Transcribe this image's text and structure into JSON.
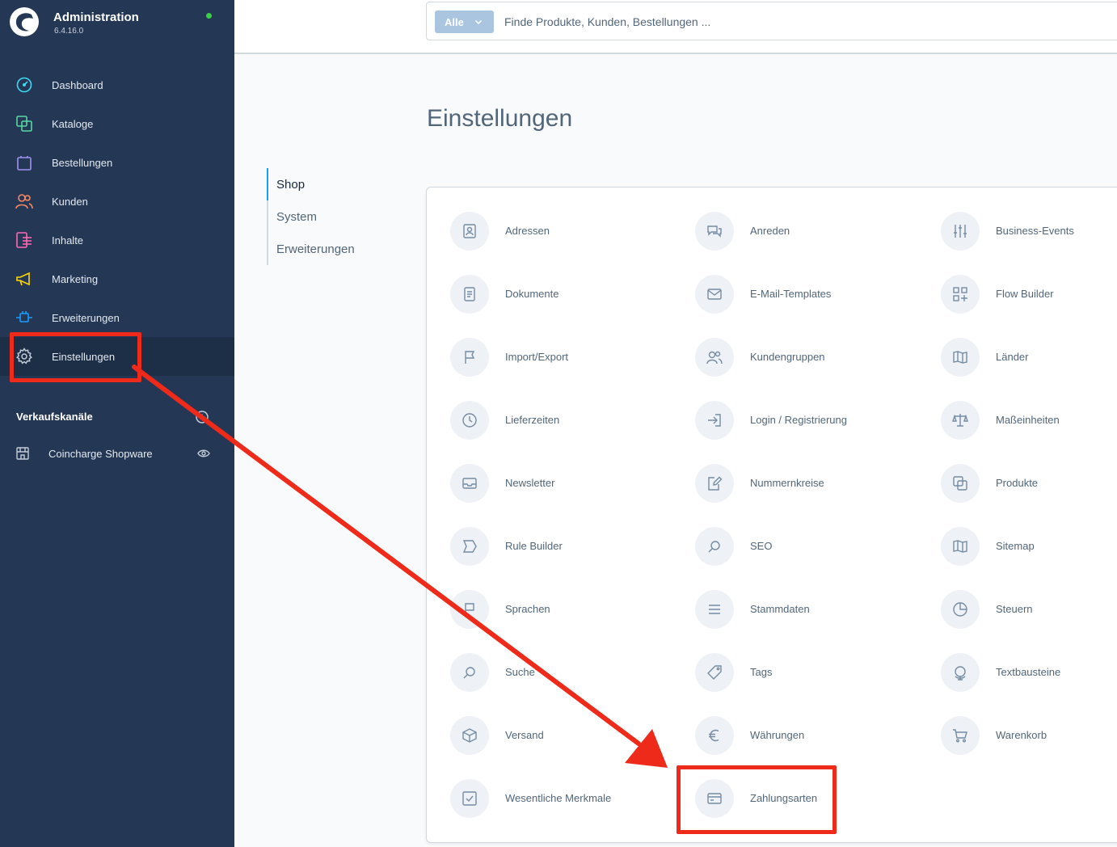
{
  "app": {
    "title": "Administration",
    "version": "6.4.16.0"
  },
  "sidebar": {
    "items": [
      {
        "label": "Dashboard",
        "icon": "dashboard-icon",
        "color": "#3ed8f4"
      },
      {
        "label": "Kataloge",
        "icon": "catalog-icon",
        "color": "#57d9a3"
      },
      {
        "label": "Bestellungen",
        "icon": "orders-icon",
        "color": "#a092f0"
      },
      {
        "label": "Kunden",
        "icon": "customers-icon",
        "color": "#f88962"
      },
      {
        "label": "Inhalte",
        "icon": "content-icon",
        "color": "#ff68b4"
      },
      {
        "label": "Marketing",
        "icon": "marketing-icon",
        "color": "#ffd700"
      },
      {
        "label": "Erweiterungen",
        "icon": "extensions-icon",
        "color": "#189eff"
      },
      {
        "label": "Einstellungen",
        "icon": "settings-icon",
        "color": "#9aa8b5",
        "active": true
      }
    ],
    "sales_channels_title": "Verkaufskanäle",
    "sales_channels": [
      {
        "label": "Coincharge Shopware"
      }
    ]
  },
  "search": {
    "type_label": "Alle",
    "placeholder": "Finde Produkte, Kunden, Bestellungen ..."
  },
  "page": {
    "title": "Einstellungen",
    "tabs": [
      {
        "label": "Shop",
        "active": true
      },
      {
        "label": "System"
      },
      {
        "label": "Erweiterungen"
      }
    ]
  },
  "settings": [
    [
      "Adressen",
      "Anreden",
      "Business-Events"
    ],
    [
      "Dokumente",
      "E-Mail-Templates",
      "Flow Builder"
    ],
    [
      "Import/Export",
      "Kundengruppen",
      "Länder"
    ],
    [
      "Lieferzeiten",
      "Login / Registrierung",
      "Maßeinheiten"
    ],
    [
      "Newsletter",
      "Nummernkreise",
      "Produkte"
    ],
    [
      "Rule Builder",
      "SEO",
      "Sitemap"
    ],
    [
      "Sprachen",
      "Stammdaten",
      "Steuern"
    ],
    [
      "Suche",
      "Tags",
      "Textbausteine"
    ],
    [
      "Versand",
      "Währungen",
      "Warenkorb"
    ],
    [
      "Wesentliche Merkmale",
      "Zahlungsarten",
      ""
    ]
  ],
  "colors": {
    "sidebar_bg": "#243754",
    "annotation_red": "#ee2a1a",
    "accent_blue": "#189eff"
  }
}
